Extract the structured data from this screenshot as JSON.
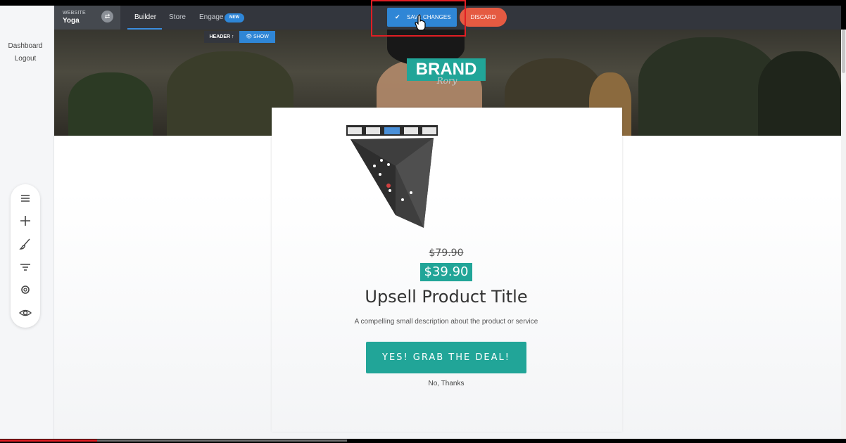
{
  "sidebar": {
    "dashboard_label": "Dashboard",
    "logout_label": "Logout",
    "tools": [
      "menu-icon",
      "plus-icon",
      "brush-icon",
      "filter-icon",
      "gear-icon",
      "eye-icon"
    ]
  },
  "topbar": {
    "site_label": "WEBSITE",
    "site_name": "Yoga",
    "tabs": [
      "Builder",
      "Store",
      "Engage"
    ],
    "new_badge": "NEW",
    "save_label": "SAVE CHANGES",
    "discard_label": "DISCARD"
  },
  "header_controls": {
    "header_label": "HEADER",
    "show_label": "SHOW"
  },
  "hero": {
    "brand": "BRAND",
    "script": "Rory"
  },
  "offer": {
    "old_price": "$79.90",
    "new_price": "$39.90",
    "title": "Upsell Product Title",
    "description": "A compelling small description about the product or service",
    "cta_label": "YES! GRAB THE DEAL!",
    "decline_label": "No, Thanks"
  },
  "video": {
    "progress": 0.115,
    "buffered": 0.41
  },
  "colors": {
    "accent_teal": "#21a598",
    "primary_blue": "#2f86d6",
    "discard_red": "#e55a42",
    "topbar_dark": "#33363d"
  }
}
